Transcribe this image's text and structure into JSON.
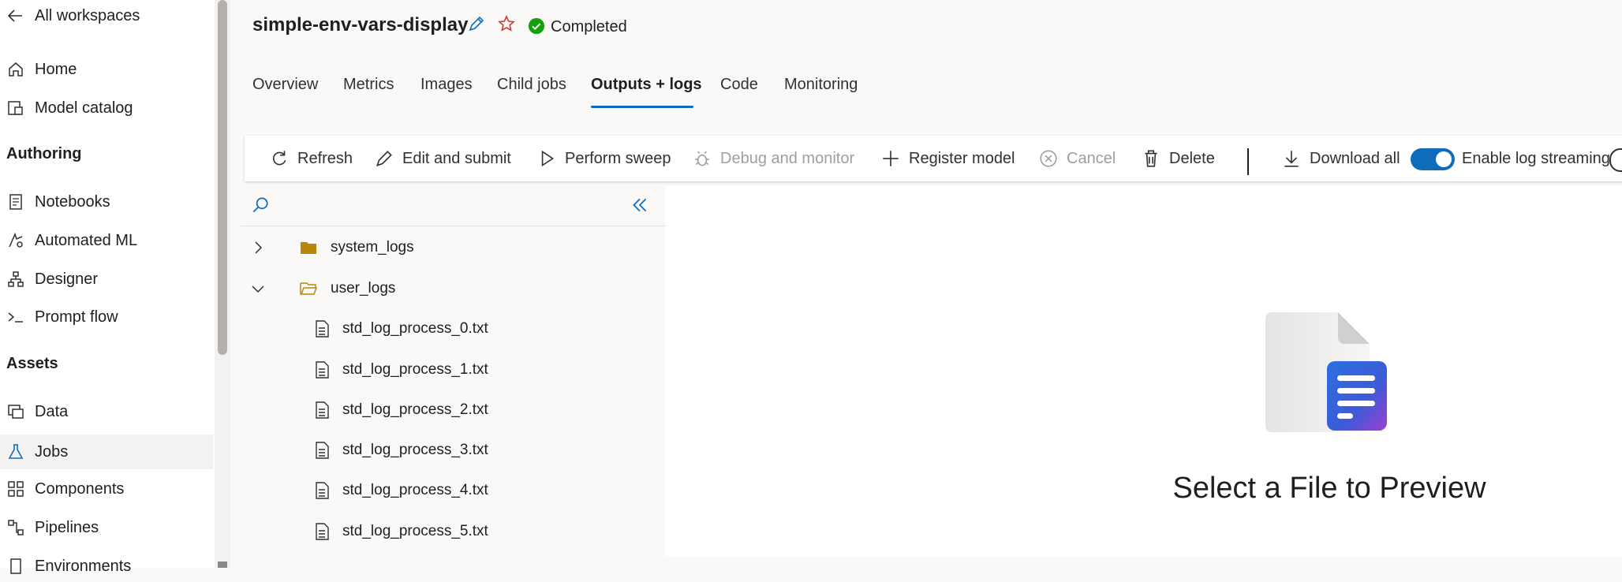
{
  "sidebar": {
    "back_label": "All workspaces",
    "items_top": [
      {
        "label": "Home",
        "icon": "home-icon"
      },
      {
        "label": "Model catalog",
        "icon": "catalog-icon"
      }
    ],
    "authoring_heading": "Authoring",
    "authoring_items": [
      {
        "label": "Notebooks",
        "icon": "notebook-icon"
      },
      {
        "label": "Automated ML",
        "icon": "automl-icon"
      },
      {
        "label": "Designer",
        "icon": "designer-icon"
      },
      {
        "label": "Prompt flow",
        "icon": "promptflow-icon"
      }
    ],
    "assets_heading": "Assets",
    "assets_items": [
      {
        "label": "Data",
        "icon": "data-icon"
      },
      {
        "label": "Jobs",
        "icon": "flask-icon",
        "active": true
      },
      {
        "label": "Components",
        "icon": "components-icon"
      },
      {
        "label": "Pipelines",
        "icon": "pipelines-icon"
      },
      {
        "label": "Environments",
        "icon": "environments-icon"
      }
    ]
  },
  "header": {
    "job_name": "simple-env-vars-display",
    "status": "Completed",
    "status_color": "#13a10e"
  },
  "tabs": [
    {
      "label": "Overview"
    },
    {
      "label": "Metrics"
    },
    {
      "label": "Images"
    },
    {
      "label": "Child jobs"
    },
    {
      "label": "Outputs + logs",
      "active": true
    },
    {
      "label": "Code"
    },
    {
      "label": "Monitoring"
    }
  ],
  "toolbar": {
    "refresh": "Refresh",
    "edit_submit": "Edit and submit",
    "perform_sweep": "Perform sweep",
    "debug_monitor": "Debug and monitor",
    "register_model": "Register model",
    "cancel": "Cancel",
    "delete": "Delete",
    "download_all": "Download all",
    "log_streaming": "Enable log streaming",
    "log_streaming_on": true,
    "accent_color": "#0f6cbd"
  },
  "file_tree": {
    "folders": [
      {
        "name": "system_logs",
        "expanded": false
      },
      {
        "name": "user_logs",
        "expanded": true
      }
    ],
    "files": [
      "std_log_process_0.txt",
      "std_log_process_1.txt",
      "std_log_process_2.txt",
      "std_log_process_3.txt",
      "std_log_process_4.txt",
      "std_log_process_5.txt"
    ]
  },
  "preview": {
    "empty_message": "Select a File to Preview"
  }
}
